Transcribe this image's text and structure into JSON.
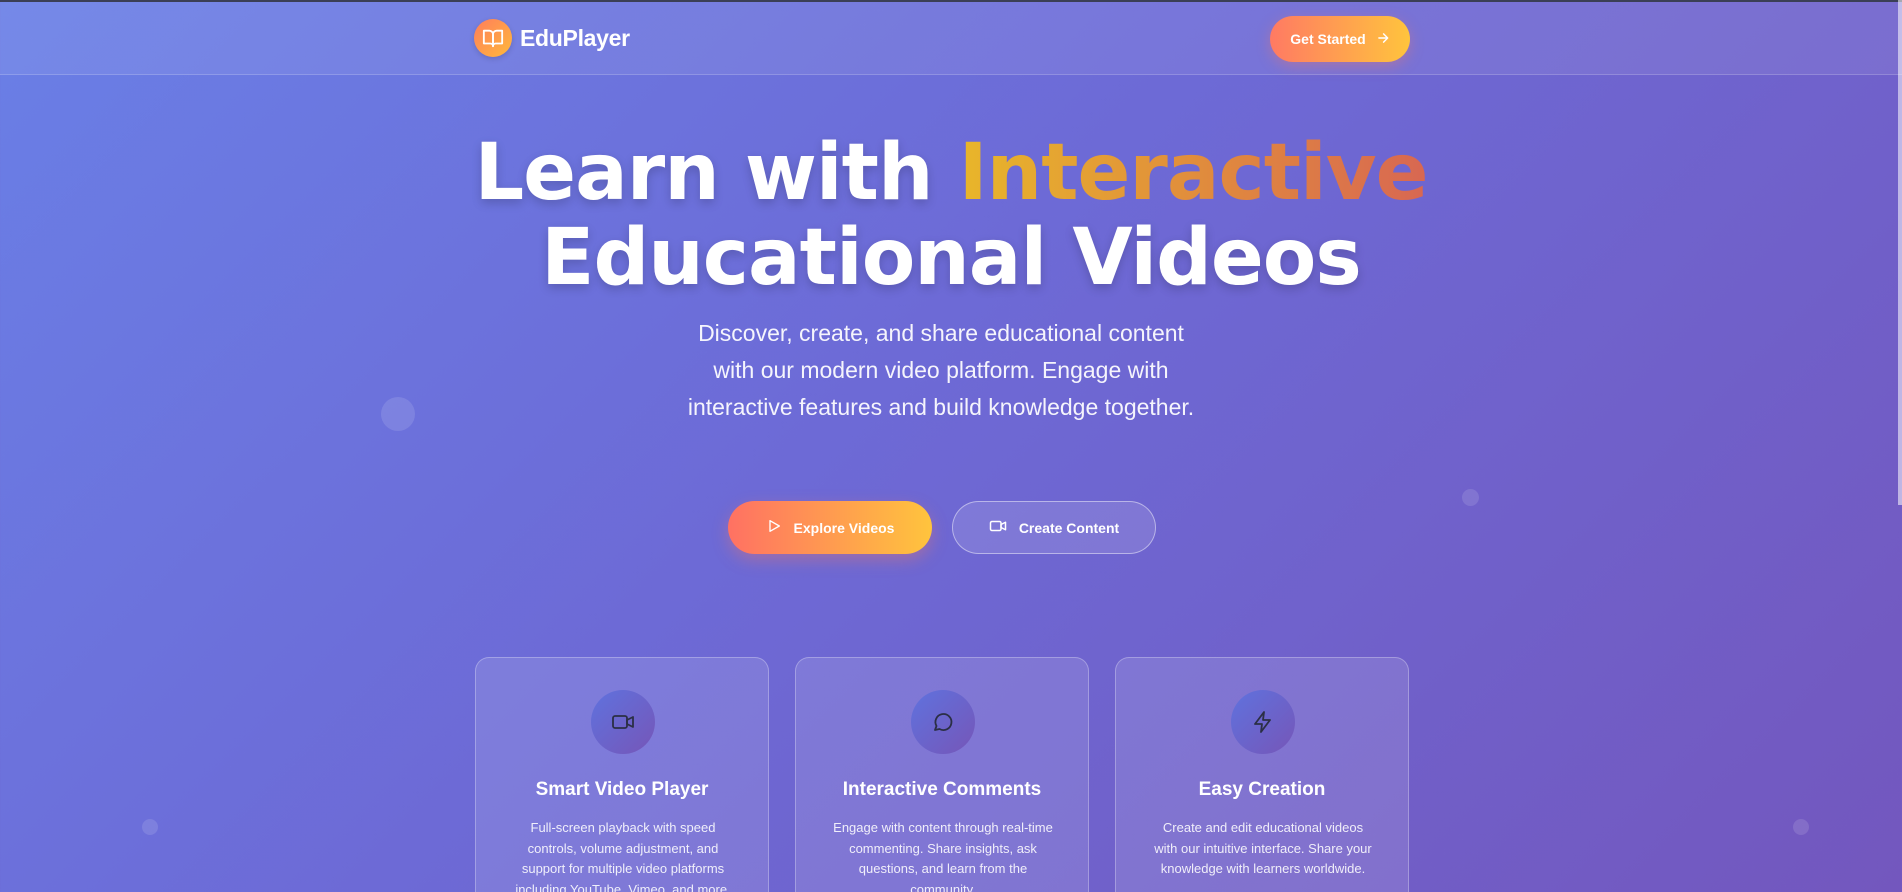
{
  "header": {
    "brand": "EduPlayer",
    "get_started_label": "Get Started"
  },
  "hero": {
    "title_prefix": "Learn with ",
    "title_accent": "Interactive",
    "title_line2": "Educational Videos",
    "subtitle": "Discover, create, and share educational content with our modern video platform. Engage with interactive features and build knowledge together.",
    "explore_label": "Explore Videos",
    "create_label": "Create Content"
  },
  "features": [
    {
      "icon": "video-camera-icon",
      "title": "Smart Video Player",
      "text": "Full-screen playback with speed controls, volume adjustment, and support for multiple video platforms including YouTube, Vimeo, and more."
    },
    {
      "icon": "chat-bubble-icon",
      "title": "Interactive Comments",
      "text": "Engage with content through real-time commenting. Share insights, ask questions, and learn from the community."
    },
    {
      "icon": "lightning-icon",
      "title": "Easy Creation",
      "text": "Create and edit educational videos with our intuitive interface. Share your knowledge with learners worldwide."
    }
  ],
  "colors": {
    "accent_orange": "#ff7a63",
    "accent_yellow": "#ffc43d",
    "background_start": "#6a7fe6",
    "background_end": "#7357be"
  }
}
